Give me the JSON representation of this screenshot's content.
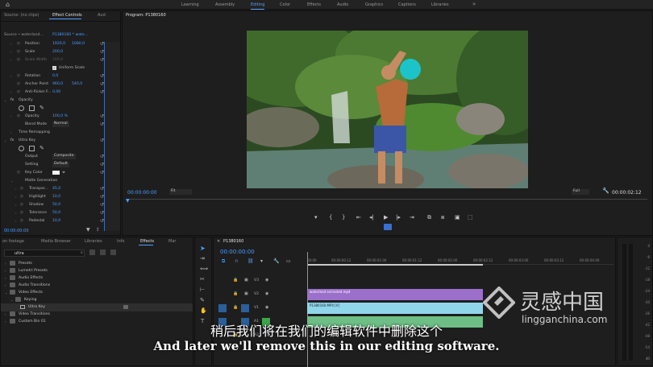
{
  "workspace": {
    "tabs": [
      "Learning",
      "Assembly",
      "Editing",
      "Color",
      "Effects",
      "Audio",
      "Graphics",
      "Captions",
      "Libraries"
    ],
    "active": "Editing",
    "more": "»"
  },
  "effect_controls": {
    "tabs": [
      "Source: (no clips)",
      "Effect Controls",
      "Aud"
    ],
    "source_line": "Source • waterland...",
    "seq_line": "P1380160 * wate...",
    "rows": [
      {
        "label": "Position",
        "v1": "1920,0",
        "v2": "1080,0"
      },
      {
        "label": "Scale",
        "v1": "200,0"
      },
      {
        "label": "Scale Width",
        "v1": "100,0"
      },
      {
        "label": "Uniform Scale"
      },
      {
        "label": "Rotation",
        "v1": "0,0"
      },
      {
        "label": "Anchor Point",
        "v1": "960,0",
        "v2": "540,0"
      },
      {
        "label": "Anti-flicker F...",
        "v1": "0,00"
      },
      {
        "label": "Opacity"
      },
      {
        "label": "Opacity",
        "v1": "100,0 %"
      },
      {
        "label": "Blend Mode",
        "sel": "Normal"
      },
      {
        "label": "Time Remapping"
      },
      {
        "label": "Ultra Key"
      },
      {
        "label": "Output",
        "sel": "Composite"
      },
      {
        "label": "Setting",
        "sel": "Default"
      },
      {
        "label": "Key Color"
      },
      {
        "label": "Matte Generation"
      },
      {
        "label": "Transpar...",
        "v1": "45,0"
      },
      {
        "label": "Highlight",
        "v1": "10,0"
      },
      {
        "label": "Shadow",
        "v1": "50,0"
      },
      {
        "label": "Tolerance",
        "v1": "50,0"
      },
      {
        "label": "Pedestal",
        "v1": "10,0"
      }
    ],
    "fx": "fx",
    "timecode": "00:00:00:00"
  },
  "program": {
    "title": "Program: P1380160",
    "timecode": "00:00:00:00",
    "fit": "Fit",
    "quality": "Full",
    "duration": "00:00:02:12",
    "controls": [
      "⎯",
      "{",
      "}",
      "⇤",
      "◀",
      "▶",
      "▷",
      "⇥",
      "⧉",
      "⧉",
      "⬚",
      "⬚"
    ]
  },
  "project": {
    "tabs": [
      "on footage",
      "Media Browser",
      "Libraries",
      "Info",
      "Effects",
      "Mar"
    ],
    "active_tab": "Effects",
    "search": "ultra",
    "tree": [
      {
        "label": "Presets",
        "level": 0
      },
      {
        "label": "Lumetri Presets",
        "level": 0
      },
      {
        "label": "Audio Effects",
        "level": 0
      },
      {
        "label": "Audio Transitions",
        "level": 0
      },
      {
        "label": "Video Effects",
        "level": 0
      },
      {
        "label": "Keying",
        "level": 1
      },
      {
        "label": "Ultra Key",
        "level": 2
      },
      {
        "label": "Video Transitions",
        "level": 0
      },
      {
        "label": "Custom Bin 01",
        "level": 0
      }
    ]
  },
  "timeline": {
    "sequence": "P1380160",
    "timecode": "00:00:00:00",
    "ruler": [
      "00:00",
      "00:00:00:12",
      "00:00:01:00",
      "00:00:01:12",
      "00:00:02:00",
      "00:00:02:12",
      "00:00:03:00",
      "00:00:03:12",
      "00:00:04:00"
    ],
    "track_labels": [
      "V3",
      "V2",
      "V1",
      "A1",
      "A2"
    ],
    "clips": [
      {
        "name": "waterland animated.mp4"
      },
      {
        "name": "P1380160.MP4 [V]"
      }
    ]
  },
  "meter": {
    "labels": [
      "0",
      "-6",
      "-12",
      "-18",
      "-24",
      "-30",
      "-36",
      "-42",
      "-48",
      "-54"
    ],
    "unit": "dB"
  },
  "subtitles": {
    "zh": "稍后我们将在我们的编辑软件中删除这个",
    "en": "And later we'll remove this in our editing software."
  },
  "watermark": {
    "zh": "灵感中国",
    "url": "lingganchina.com"
  },
  "colors": {
    "accent": "#4ea2ff",
    "clip_purple": "#9c6fcb",
    "clip_cyan": "#8fd6ea",
    "playhead": "#4ea2ff"
  }
}
